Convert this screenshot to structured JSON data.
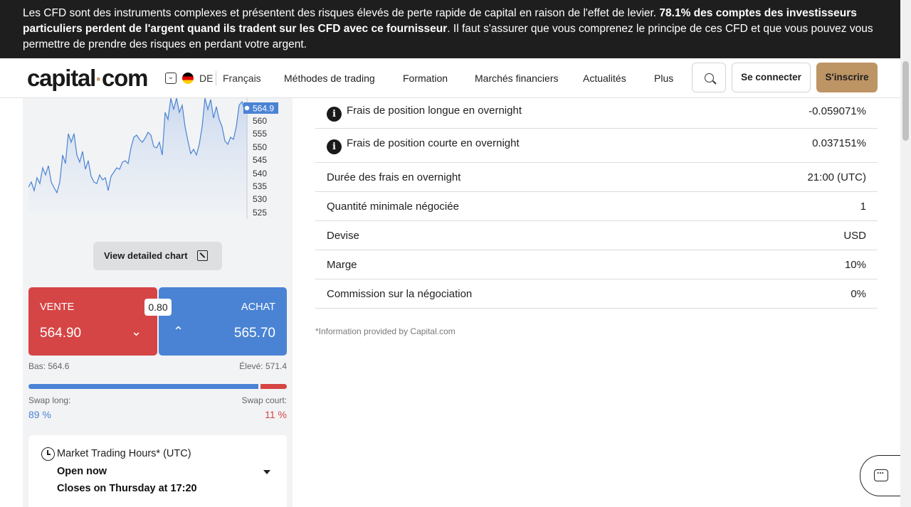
{
  "risk_banner": {
    "text_before": "Les CFD sont des instruments complexes et présentent des risques élevés de perte rapide de capital en raison de l'effet de levier. ",
    "text_bold": "78.1% des comptes des investisseurs particuliers perdent de l'argent quand ils tradent sur les CFD avec ce fournisseur",
    "text_after": ". Il faut s'assurer que vous comprenez le principe de ces CFD et que vous pouvez vous permettre de prendre des risques en perdant votre argent."
  },
  "header": {
    "logo_left": "capital",
    "logo_dot": "·",
    "logo_right": "com",
    "country_code": "DE",
    "language": "Français",
    "nav": [
      "Méthodes de trading",
      "Formation",
      "Marchés financiers",
      "Actualités",
      "Plus"
    ],
    "login_label": "Se connecter",
    "signup_label": "S'inscrire"
  },
  "chart": {
    "current_price_tag": "564.9",
    "y_ticks": [
      "560",
      "555",
      "550",
      "545",
      "540",
      "535",
      "530",
      "525"
    ],
    "button_label": "View detailed chart",
    "line_color": "#4a83d4"
  },
  "trade": {
    "sell_label": "VENTE",
    "sell_price": "564.90",
    "buy_label": "ACHAT",
    "buy_price": "565.70",
    "spread": "0.80",
    "low_label": "Bas: 564.6",
    "high_label": "Élevé: 571.4",
    "swap_long_label": "Swap long:",
    "swap_long_value": "89 %",
    "swap_long_fraction": 0.89,
    "swap_short_label": "Swap court:",
    "swap_short_value": "11 %",
    "sell_color": "#d64545",
    "buy_color": "#4a83d4"
  },
  "hours": {
    "title": "Market Trading Hours* (UTC)",
    "status": "Open now",
    "closes": "Closes on Thursday at 17:20"
  },
  "details": {
    "rows": [
      {
        "label": "Frais de position longue en overnight",
        "value": "-0.059071%",
        "info": true
      },
      {
        "label": "Frais de position courte en overnight",
        "value": "0.037151%",
        "info": true
      },
      {
        "label": "Durée des frais en overnight",
        "value": "21:00 (UTC)",
        "info": false
      },
      {
        "label": "Quantité minimale négociée",
        "value": "1",
        "info": false
      },
      {
        "label": "Devise",
        "value": "USD",
        "info": false
      },
      {
        "label": "Marge",
        "value": "10%",
        "info": false
      },
      {
        "label": "Commission sur la négociation",
        "value": "0%",
        "info": false
      }
    ],
    "footnote": "*Information provided by Capital.com"
  }
}
